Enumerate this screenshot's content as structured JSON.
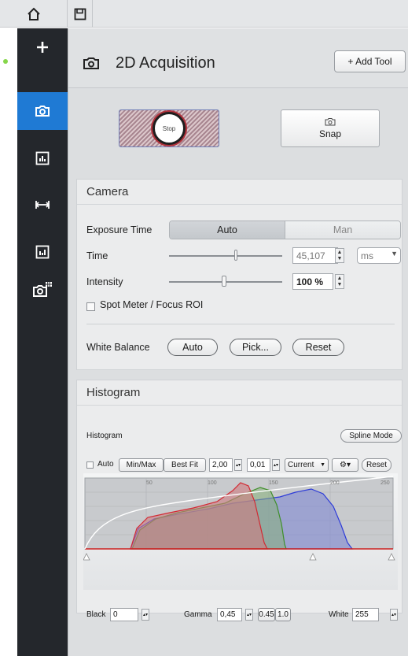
{
  "toolbar": {
    "home_icon": "home-icon",
    "save_icon": "save-icon"
  },
  "sidebar": {
    "items": [
      {
        "icon": "plus-icon"
      },
      {
        "icon": "camera-icon",
        "active": true
      },
      {
        "icon": "bar-chart-icon"
      },
      {
        "icon": "measure-icon"
      },
      {
        "icon": "histogram-icon"
      },
      {
        "icon": "camera-grid-icon"
      }
    ],
    "status_color": "#86d64a",
    "active_color": "#1f7ad4"
  },
  "header": {
    "title": "2D Acquisition",
    "add_tool": "+ Add Tool"
  },
  "acquire": {
    "stop_label": "Stop",
    "snap_label": "Snap"
  },
  "camera": {
    "title": "Camera",
    "exposure_label": "Exposure Time",
    "exposure_auto": "Auto",
    "exposure_man": "Man",
    "exposure_mode": "Auto",
    "time_label": "Time",
    "time_value": "45,107",
    "time_unit": "ms",
    "time_slider": 0.6,
    "intensity_label": "Intensity",
    "intensity_value": "100 %",
    "intensity_slider": 0.5,
    "spot_meter": "Spot Meter / Focus ROI",
    "wb_label": "White Balance",
    "wb_auto": "Auto",
    "wb_pick": "Pick...",
    "wb_reset": "Reset"
  },
  "histogram": {
    "title": "Histogram",
    "sub_label": "Histogram",
    "spline_mode": "Spline Mode",
    "auto": "Auto",
    "minmax": "Min/Max",
    "bestfit": "Best Fit",
    "val1": "2,00",
    "val2": "0,01",
    "channel": "Current",
    "reset": "Reset",
    "ticks": [
      "50",
      "100",
      "150",
      "200",
      "250"
    ],
    "black_label": "Black",
    "black_value": "0",
    "gamma_label": "Gamma",
    "gamma_value": "0,45",
    "gamma_a": "0.45",
    "gamma_b": "1.0",
    "white_label": "White",
    "white_value": "255"
  }
}
